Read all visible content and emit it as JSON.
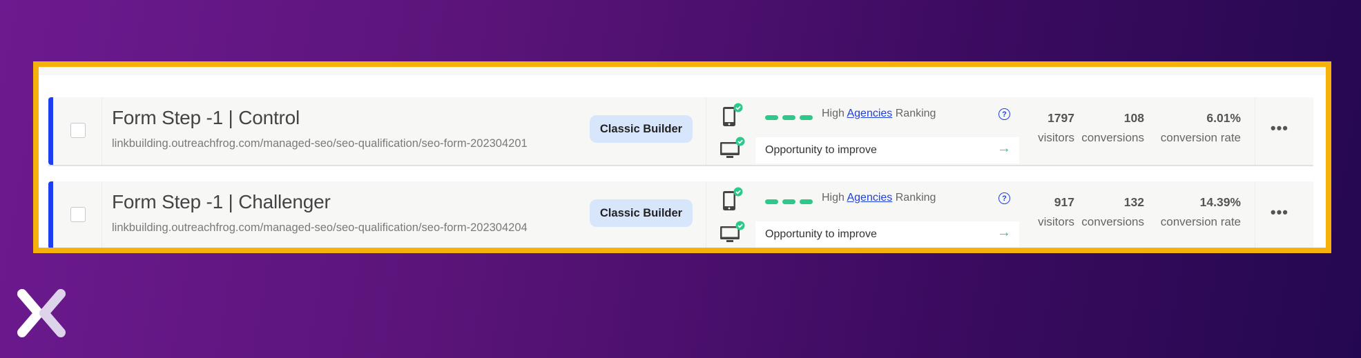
{
  "rows": [
    {
      "title": "Form Step -1 | Control",
      "url": "linkbuilding.outreachfrog.com/managed-seo/seo-qualification/seo-form-202304201",
      "builder": "Classic Builder",
      "ranking_prefix": "High",
      "ranking_link": "Agencies",
      "ranking_suffix": "Ranking",
      "help": "?",
      "opportunity": "Opportunity to improve",
      "arrow": "→",
      "visitors": "1797",
      "visitors_label": "visitors",
      "conversions": "108",
      "conversions_label": "conversions",
      "rate": "6.01%",
      "rate_label": "conversion rate",
      "more": "•••"
    },
    {
      "title": "Form Step -1 | Challenger",
      "url": "linkbuilding.outreachfrog.com/managed-seo/seo-qualification/seo-form-202304204",
      "builder": "Classic Builder",
      "ranking_prefix": "High",
      "ranking_link": "Agencies",
      "ranking_suffix": "Ranking",
      "help": "?",
      "opportunity": "Opportunity to improve",
      "arrow": "→",
      "visitors": "917",
      "visitors_label": "visitors",
      "conversions": "132",
      "conversions_label": "conversions",
      "rate": "14.39%",
      "rate_label": "conversion rate",
      "more": "•••"
    }
  ],
  "colors": {
    "frame": "#f6b10a",
    "accent": "#1e3ff0",
    "success": "#2cc98a",
    "badge_bg": "#d8e6fb",
    "link": "#1e3fd8"
  }
}
